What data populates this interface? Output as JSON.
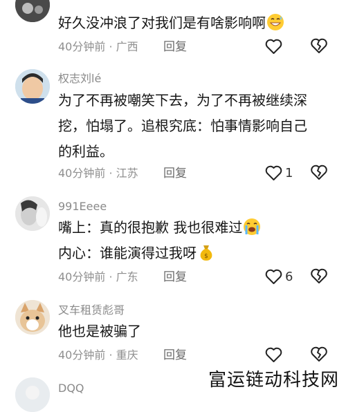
{
  "comments": [
    {
      "username": "",
      "lines": [
        "好久没冲浪了对我们是有啥影响啊"
      ],
      "time": "40分钟前",
      "location": "广西",
      "reply_label": "回复",
      "likes": ""
    },
    {
      "username": "权志刘lé",
      "lines": [
        "为了不再被嘲笑下去，为了不再被继续深",
        "挖，怕塌了。追根究底：怕事情影响自己",
        "的利益。"
      ],
      "time": "40分钟前",
      "location": "江苏",
      "reply_label": "回复",
      "likes": "1"
    },
    {
      "username": "991Eeee",
      "lines": [
        "嘴上：真的很抱歉 我也很难过",
        "内心：谁能演得过我呀"
      ],
      "time": "40分钟前",
      "location": "广东",
      "reply_label": "回复",
      "likes": "6"
    },
    {
      "username": "叉车租赁彪哥",
      "lines": [
        "他也是被骗了"
      ],
      "time": "40分钟前",
      "location": "重庆",
      "reply_label": "回复",
      "likes": ""
    },
    {
      "username": "DQQ",
      "lines": [],
      "time": "",
      "location": "",
      "reply_label": "",
      "likes": ""
    }
  ],
  "meta_separator": " · ",
  "watermark": "富运链动科技网",
  "icons": {
    "like": "heart-outline-icon",
    "dislike": "broken-heart-outline-icon"
  }
}
